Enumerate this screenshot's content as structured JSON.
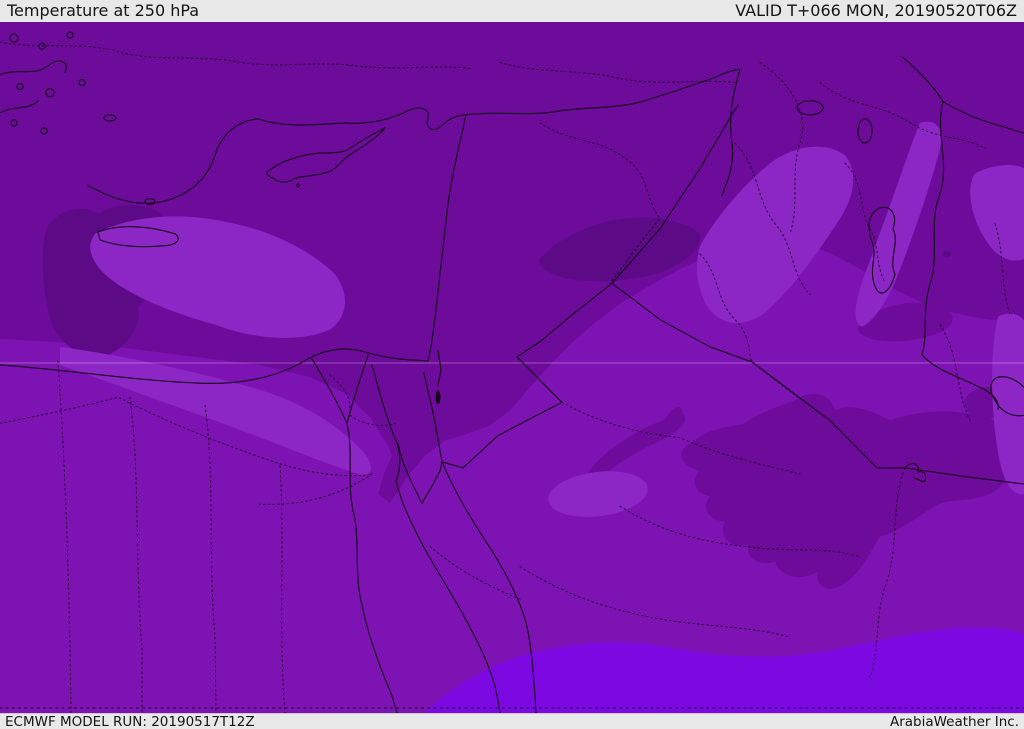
{
  "header": {
    "title": "Temperature at 250 hPa",
    "valid_time": "VALID T+066 MON, 20190520T06Z"
  },
  "footer": {
    "model_run": "ECMWF MODEL RUN: 20190517T12Z",
    "credit": "ArabiaWeather Inc."
  },
  "map": {
    "region": "Middle East",
    "levels": [
      {
        "name": "temp-level-coldest",
        "color": "#5c0a86"
      },
      {
        "name": "temp-level-colder",
        "color": "#6d0b9b"
      },
      {
        "name": "temp-level-cold",
        "color": "#7e13b4"
      },
      {
        "name": "temp-level-mild",
        "color": "#8c27c6"
      },
      {
        "name": "temp-level-warm",
        "color": "#7d09e2"
      }
    ],
    "line_color": "#16001a",
    "gridline_color": "rgba(255,255,255,0.30)",
    "bar_background": "#e8e8e8",
    "text_color": "#141414"
  }
}
